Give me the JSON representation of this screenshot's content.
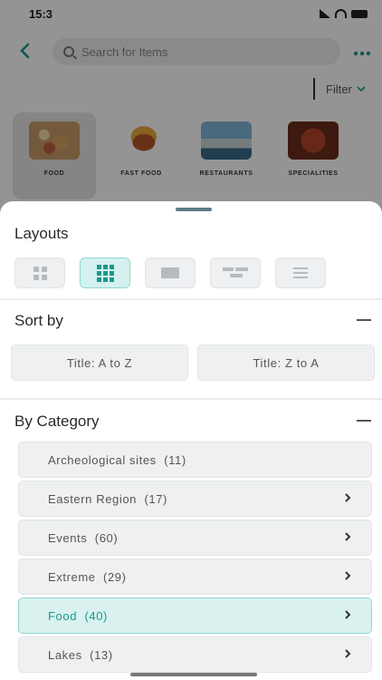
{
  "status_bar": {
    "time": "15:3"
  },
  "header": {
    "back_icon": "chevron-left-icon",
    "search_placeholder": "Search for Items",
    "more_icon": "more-dots-icon",
    "filter_label": "Filter"
  },
  "categories_strip": [
    {
      "label": "FOOD",
      "selected": true
    },
    {
      "label": "FAST FOOD",
      "selected": false
    },
    {
      "label": "RESTAURANTS",
      "selected": false
    },
    {
      "label": "SPECIALITIES",
      "selected": false
    }
  ],
  "sheet": {
    "layouts_title": "Layouts",
    "layouts": [
      {
        "icon": "grid-2x2-icon",
        "selected": false
      },
      {
        "icon": "grid-3x3-icon",
        "selected": true
      },
      {
        "icon": "single-card-icon",
        "selected": false
      },
      {
        "icon": "detail-list-icon",
        "selected": false
      },
      {
        "icon": "list-lines-icon",
        "selected": false
      }
    ],
    "sort_title": "Sort by",
    "sort_options": [
      "Title: A to Z",
      "Title: Z to A"
    ],
    "category_title": "By Category",
    "categories": [
      {
        "label": "Archeological sites",
        "count": "(11)",
        "has_chevron": false,
        "selected": false
      },
      {
        "label": "Eastern Region",
        "count": "(17)",
        "has_chevron": true,
        "selected": false
      },
      {
        "label": "Events",
        "count": "(60)",
        "has_chevron": true,
        "selected": false
      },
      {
        "label": "Extreme",
        "count": "(29)",
        "has_chevron": true,
        "selected": false
      },
      {
        "label": "Food",
        "count": "(40)",
        "has_chevron": true,
        "selected": true
      },
      {
        "label": "Lakes",
        "count": "(13)",
        "has_chevron": true,
        "selected": false
      }
    ]
  },
  "colors": {
    "accent": "#1a9a8a",
    "selected_bg": "#d9f1ef",
    "button_bg": "#eef0f1"
  }
}
